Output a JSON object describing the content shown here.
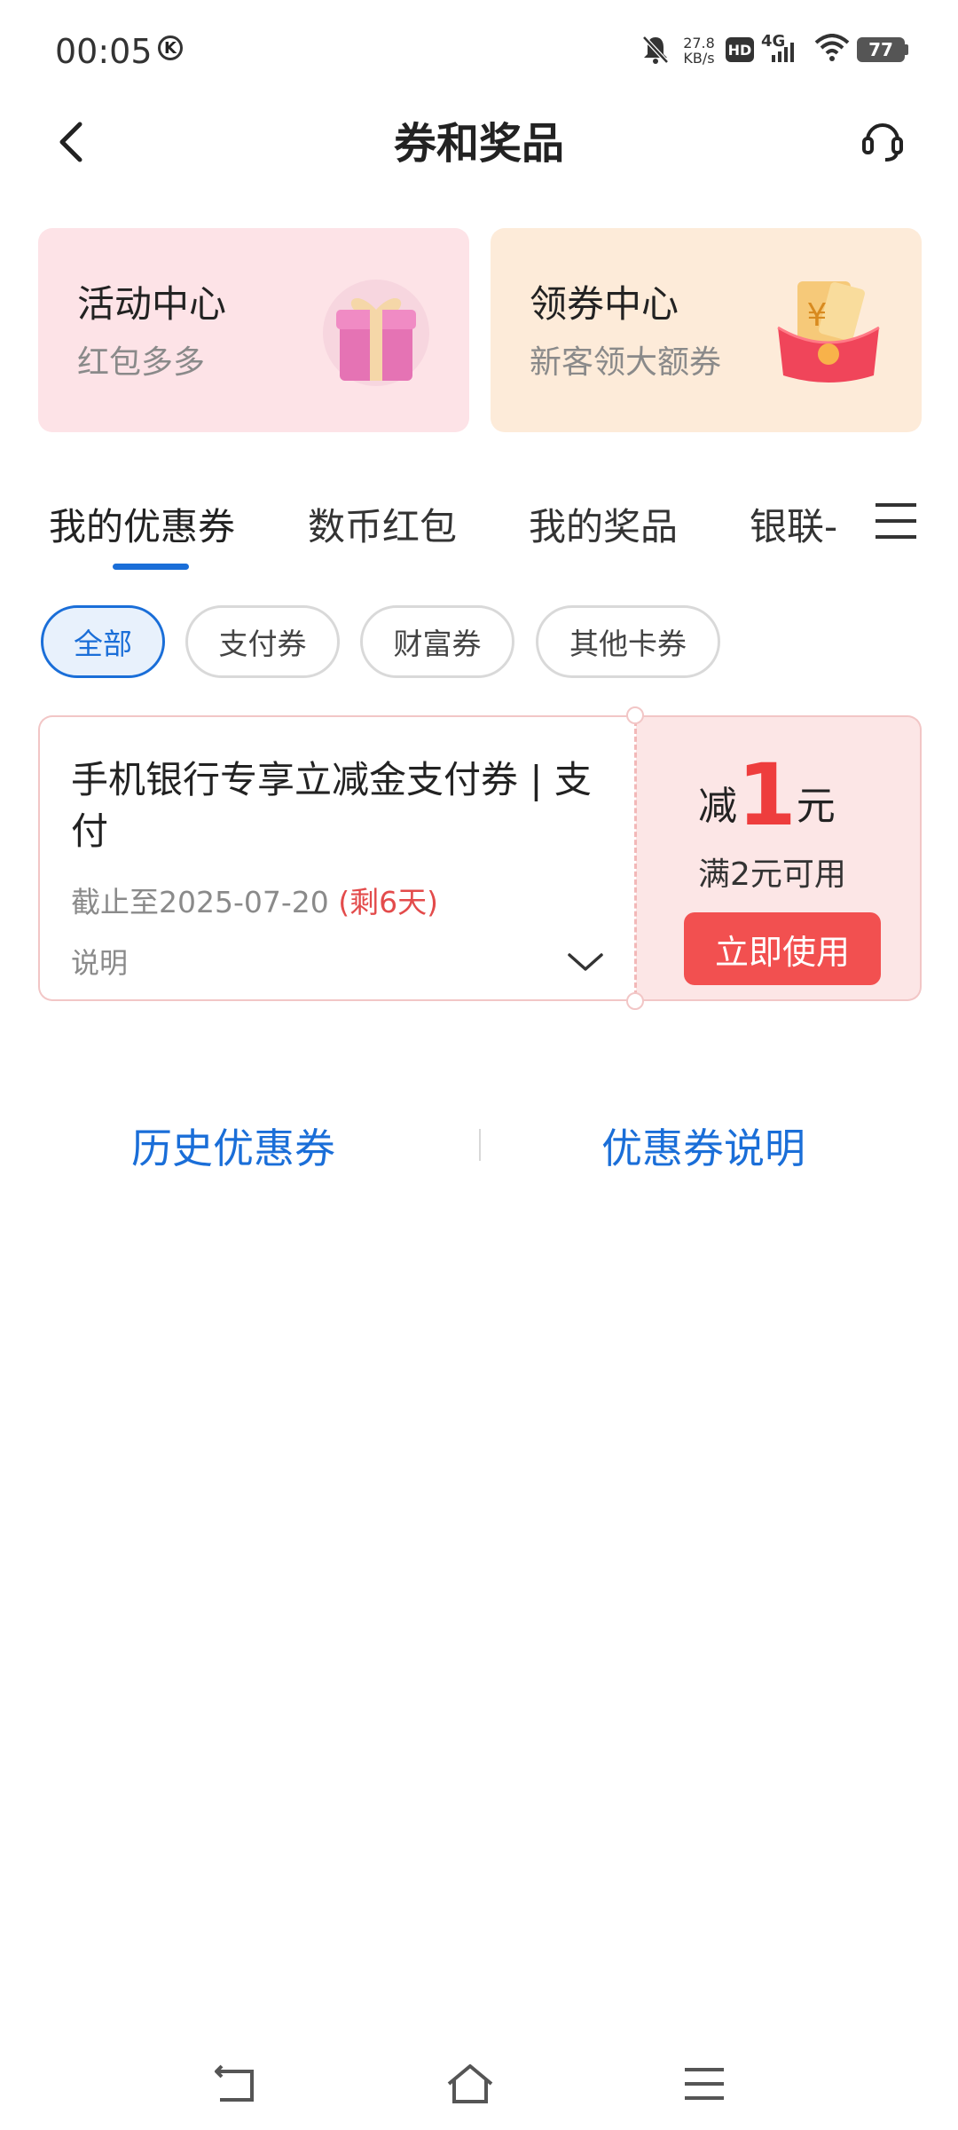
{
  "status_bar": {
    "time": "00:05",
    "k_badge": "K",
    "net_speed_value": "27.8",
    "net_speed_unit": "KB/s",
    "hd": "HD",
    "network": "4G",
    "battery": "77"
  },
  "header": {
    "title": "券和奖品"
  },
  "promo_cards": [
    {
      "title": "活动中心",
      "subtitle": "红包多多"
    },
    {
      "title": "领券中心",
      "subtitle": "新客领大额券"
    }
  ],
  "tabs": [
    {
      "label": "我的优惠券",
      "active": true
    },
    {
      "label": "数币红包",
      "active": false
    },
    {
      "label": "我的奖品",
      "active": false
    },
    {
      "label": "银联-",
      "active": false
    }
  ],
  "filter_chips": [
    {
      "label": "全部",
      "active": true
    },
    {
      "label": "支付券",
      "active": false
    },
    {
      "label": "财富券",
      "active": false
    },
    {
      "label": "其他卡券",
      "active": false
    }
  ],
  "coupon": {
    "title": "手机银行专享立减金支付券 | 支付",
    "deadline": "截止至2025-07-20",
    "remaining": "(剩6天)",
    "description_label": "说明",
    "amount_prefix": "减",
    "amount": "1",
    "amount_unit": "元",
    "condition": "满2元可用",
    "use_button": "立即使用"
  },
  "links": {
    "history": "历史优惠券",
    "explain": "优惠券说明"
  },
  "colors": {
    "accent": "#1a6ed8",
    "coupon_red": "#f25050",
    "card_pink": "#fde3e7",
    "card_peach": "#fdebd9"
  }
}
